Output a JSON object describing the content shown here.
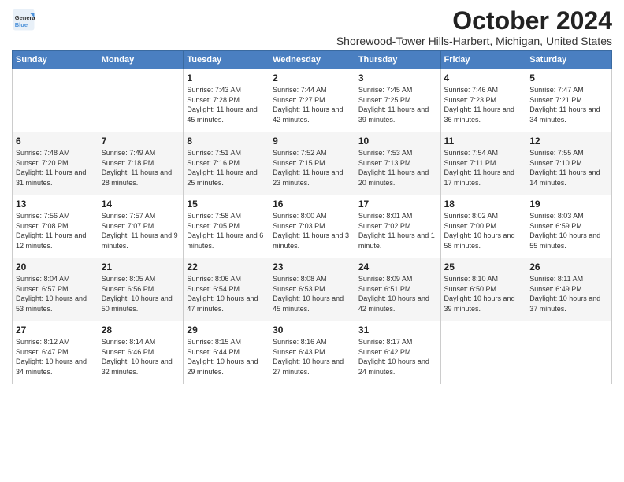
{
  "logo": {
    "line1": "General",
    "line2": "Blue"
  },
  "title": "October 2024",
  "subtitle": "Shorewood-Tower Hills-Harbert, Michigan, United States",
  "columns": [
    "Sunday",
    "Monday",
    "Tuesday",
    "Wednesday",
    "Thursday",
    "Friday",
    "Saturday"
  ],
  "weeks": [
    [
      {
        "day": "",
        "info": ""
      },
      {
        "day": "",
        "info": ""
      },
      {
        "day": "1",
        "info": "Sunrise: 7:43 AM\nSunset: 7:28 PM\nDaylight: 11 hours and 45 minutes."
      },
      {
        "day": "2",
        "info": "Sunrise: 7:44 AM\nSunset: 7:27 PM\nDaylight: 11 hours and 42 minutes."
      },
      {
        "day": "3",
        "info": "Sunrise: 7:45 AM\nSunset: 7:25 PM\nDaylight: 11 hours and 39 minutes."
      },
      {
        "day": "4",
        "info": "Sunrise: 7:46 AM\nSunset: 7:23 PM\nDaylight: 11 hours and 36 minutes."
      },
      {
        "day": "5",
        "info": "Sunrise: 7:47 AM\nSunset: 7:21 PM\nDaylight: 11 hours and 34 minutes."
      }
    ],
    [
      {
        "day": "6",
        "info": "Sunrise: 7:48 AM\nSunset: 7:20 PM\nDaylight: 11 hours and 31 minutes."
      },
      {
        "day": "7",
        "info": "Sunrise: 7:49 AM\nSunset: 7:18 PM\nDaylight: 11 hours and 28 minutes."
      },
      {
        "day": "8",
        "info": "Sunrise: 7:51 AM\nSunset: 7:16 PM\nDaylight: 11 hours and 25 minutes."
      },
      {
        "day": "9",
        "info": "Sunrise: 7:52 AM\nSunset: 7:15 PM\nDaylight: 11 hours and 23 minutes."
      },
      {
        "day": "10",
        "info": "Sunrise: 7:53 AM\nSunset: 7:13 PM\nDaylight: 11 hours and 20 minutes."
      },
      {
        "day": "11",
        "info": "Sunrise: 7:54 AM\nSunset: 7:11 PM\nDaylight: 11 hours and 17 minutes."
      },
      {
        "day": "12",
        "info": "Sunrise: 7:55 AM\nSunset: 7:10 PM\nDaylight: 11 hours and 14 minutes."
      }
    ],
    [
      {
        "day": "13",
        "info": "Sunrise: 7:56 AM\nSunset: 7:08 PM\nDaylight: 11 hours and 12 minutes."
      },
      {
        "day": "14",
        "info": "Sunrise: 7:57 AM\nSunset: 7:07 PM\nDaylight: 11 hours and 9 minutes."
      },
      {
        "day": "15",
        "info": "Sunrise: 7:58 AM\nSunset: 7:05 PM\nDaylight: 11 hours and 6 minutes."
      },
      {
        "day": "16",
        "info": "Sunrise: 8:00 AM\nSunset: 7:03 PM\nDaylight: 11 hours and 3 minutes."
      },
      {
        "day": "17",
        "info": "Sunrise: 8:01 AM\nSunset: 7:02 PM\nDaylight: 11 hours and 1 minute."
      },
      {
        "day": "18",
        "info": "Sunrise: 8:02 AM\nSunset: 7:00 PM\nDaylight: 10 hours and 58 minutes."
      },
      {
        "day": "19",
        "info": "Sunrise: 8:03 AM\nSunset: 6:59 PM\nDaylight: 10 hours and 55 minutes."
      }
    ],
    [
      {
        "day": "20",
        "info": "Sunrise: 8:04 AM\nSunset: 6:57 PM\nDaylight: 10 hours and 53 minutes."
      },
      {
        "day": "21",
        "info": "Sunrise: 8:05 AM\nSunset: 6:56 PM\nDaylight: 10 hours and 50 minutes."
      },
      {
        "day": "22",
        "info": "Sunrise: 8:06 AM\nSunset: 6:54 PM\nDaylight: 10 hours and 47 minutes."
      },
      {
        "day": "23",
        "info": "Sunrise: 8:08 AM\nSunset: 6:53 PM\nDaylight: 10 hours and 45 minutes."
      },
      {
        "day": "24",
        "info": "Sunrise: 8:09 AM\nSunset: 6:51 PM\nDaylight: 10 hours and 42 minutes."
      },
      {
        "day": "25",
        "info": "Sunrise: 8:10 AM\nSunset: 6:50 PM\nDaylight: 10 hours and 39 minutes."
      },
      {
        "day": "26",
        "info": "Sunrise: 8:11 AM\nSunset: 6:49 PM\nDaylight: 10 hours and 37 minutes."
      }
    ],
    [
      {
        "day": "27",
        "info": "Sunrise: 8:12 AM\nSunset: 6:47 PM\nDaylight: 10 hours and 34 minutes."
      },
      {
        "day": "28",
        "info": "Sunrise: 8:14 AM\nSunset: 6:46 PM\nDaylight: 10 hours and 32 minutes."
      },
      {
        "day": "29",
        "info": "Sunrise: 8:15 AM\nSunset: 6:44 PM\nDaylight: 10 hours and 29 minutes."
      },
      {
        "day": "30",
        "info": "Sunrise: 8:16 AM\nSunset: 6:43 PM\nDaylight: 10 hours and 27 minutes."
      },
      {
        "day": "31",
        "info": "Sunrise: 8:17 AM\nSunset: 6:42 PM\nDaylight: 10 hours and 24 minutes."
      },
      {
        "day": "",
        "info": ""
      },
      {
        "day": "",
        "info": ""
      }
    ]
  ]
}
